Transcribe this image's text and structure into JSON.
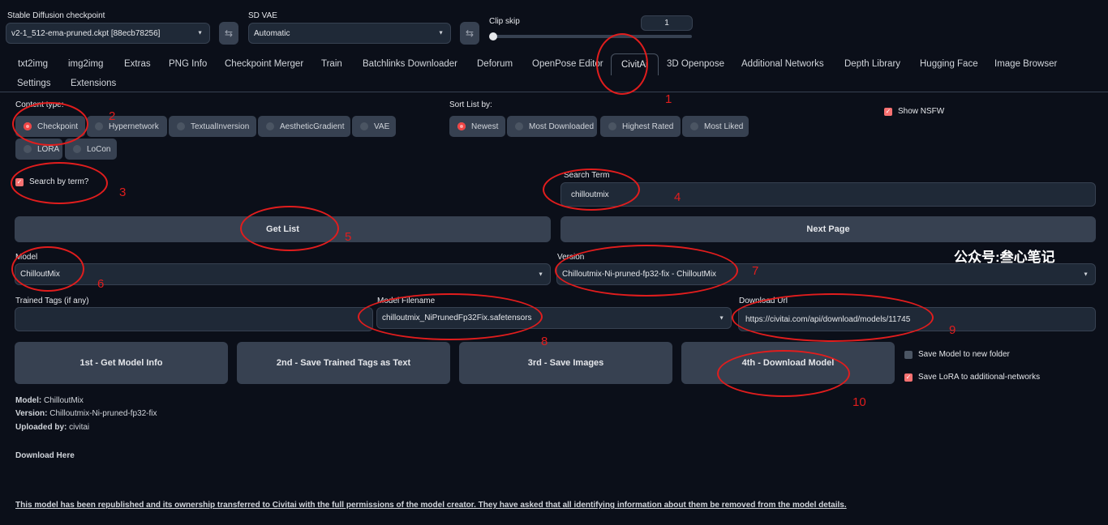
{
  "top": {
    "checkpoint_label": "Stable Diffusion checkpoint",
    "checkpoint_value": "v2-1_512-ema-pruned.ckpt [88ecb78256]",
    "vae_label": "SD VAE",
    "vae_value": "Automatic",
    "clip_label": "Clip skip",
    "clip_value": "1",
    "clip_slider_fraction": 0.0
  },
  "tabs": [
    "txt2img",
    "img2img",
    "Extras",
    "PNG Info",
    "Checkpoint Merger",
    "Train",
    "Batchlinks Downloader",
    "Deforum",
    "OpenPose Editor",
    "CivitAi",
    "3D Openpose",
    "Additional Networks",
    "Depth Library",
    "Hugging Face",
    "Image Browser",
    "Settings",
    "Extensions"
  ],
  "active_tab": "CivitAi",
  "content_type": {
    "label": "Content type:",
    "options": [
      "Checkpoint",
      "Hypernetwork",
      "TextualInversion",
      "AestheticGradient",
      "VAE",
      "LORA",
      "LoCon"
    ],
    "selected": "Checkpoint"
  },
  "sort": {
    "label": "Sort List by:",
    "options": [
      "Newest",
      "Most Downloaded",
      "Highest Rated",
      "Most Liked"
    ],
    "selected": "Newest"
  },
  "show_nsfw": {
    "label": "Show NSFW",
    "checked": true
  },
  "search_by_term": {
    "label": "Search by term?",
    "checked": true
  },
  "search_term": {
    "label": "Search Term",
    "value": "chilloutmix"
  },
  "buttons": {
    "get_list": "Get List",
    "next_page": "Next Page",
    "get_model_info": "1st - Get Model Info",
    "save_tags": "2nd - Save Trained Tags as Text",
    "save_images": "3rd - Save Images",
    "download_model": "4th - Download Model"
  },
  "model": {
    "label": "Model",
    "value": "ChilloutMix"
  },
  "version": {
    "label": "Version",
    "value": "Chilloutmix-Ni-pruned-fp32-fix - ChilloutMix"
  },
  "trained_tags": {
    "label": "Trained Tags (if any)",
    "value": ""
  },
  "model_filename": {
    "label": "Model Filename",
    "value": "chilloutmix_NiPrunedFp32Fix.safetensors"
  },
  "download_url": {
    "label": "Download Url",
    "value": "https://civitai.com/api/download/models/11745"
  },
  "options": {
    "new_folder": {
      "label": "Save Model to new folder",
      "checked": false
    },
    "save_lora": {
      "label": "Save LoRA to additional-networks",
      "checked": true
    }
  },
  "info": {
    "model_key": "Model:",
    "model_val": "ChilloutMix",
    "version_key": "Version:",
    "version_val": "Chilloutmix-Ni-pruned-fp32-fix",
    "uploaded_key": "Uploaded by:",
    "uploaded_val": "civitai",
    "download_here": "Download Here",
    "notice": "This model has been republished and its ownership transferred to Civitai with the full permissions of the model creator. They have asked that all identifying information about them be removed from the model details."
  },
  "watermark": "公众号:叁心笔记",
  "annotations": [
    "1",
    "2",
    "3",
    "4",
    "5",
    "6",
    "7",
    "8",
    "9",
    "10"
  ],
  "colors": {
    "background": "#0b0f19",
    "panel": "#1f2937",
    "button": "#374151",
    "accent": "#ef4444",
    "annotation": "#e11d1d"
  }
}
